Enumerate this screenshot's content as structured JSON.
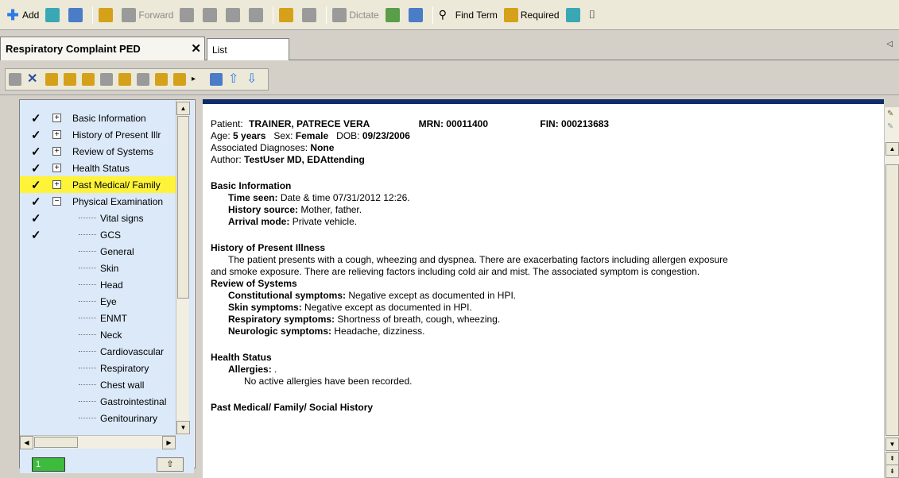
{
  "toolbar": {
    "add": "Add",
    "forward": "Forward",
    "dictate": "Dictate",
    "find_term": "Find Term",
    "required": "Required"
  },
  "tabs": {
    "active": "Respiratory Complaint PED",
    "close": "✕",
    "list": "List"
  },
  "tree": {
    "items": [
      {
        "label": "Basic Information",
        "checked": true,
        "expander": "+"
      },
      {
        "label": "History of Present Illr",
        "checked": true,
        "expander": "+"
      },
      {
        "label": "Review of Systems",
        "checked": true,
        "expander": "+"
      },
      {
        "label": "Health Status",
        "checked": true,
        "expander": "+"
      },
      {
        "label": "Past Medical/ Family",
        "checked": true,
        "expander": "+",
        "highlighted": true
      },
      {
        "label": "Physical Examination",
        "checked": true,
        "expander": "−"
      }
    ],
    "children": [
      {
        "label": "Vital signs",
        "checked": true
      },
      {
        "label": "GCS",
        "checked": true
      },
      {
        "label": "General"
      },
      {
        "label": "Skin"
      },
      {
        "label": "Head"
      },
      {
        "label": "Eye"
      },
      {
        "label": "ENMT"
      },
      {
        "label": "Neck"
      },
      {
        "label": "Cardiovascular"
      },
      {
        "label": "Respiratory"
      },
      {
        "label": "Chest wall"
      },
      {
        "label": "Gastrointestinal"
      },
      {
        "label": "Genitourinary"
      }
    ],
    "page_indicator": "1"
  },
  "document": {
    "patient_label": "Patient:",
    "patient_name": "TRAINER, PATRECE VERA",
    "mrn": "MRN: 00011400",
    "fin": "FIN: 000213683",
    "age_label": "Age:",
    "age": "5 years",
    "sex_label": "Sex:",
    "sex": "Female",
    "dob_label": "DOB:",
    "dob": "09/23/2006",
    "assoc_label": "Associated Diagnoses:",
    "assoc": "None",
    "author_label": "Author:",
    "author": "TestUser MD, EDAttending",
    "basic_title": "Basic Information",
    "time_seen_label": "Time seen:",
    "time_seen": "Date & time 07/31/2012 12:26.",
    "history_source_label": "History source:",
    "history_source": "Mother, father.",
    "arrival_label": "Arrival mode:",
    "arrival": "Private vehicle.",
    "hpi_title": "History of Present Illness",
    "hpi_line1": "The patient presents with a cough, wheezing and dyspnea.  There are exacerbating factors including allergen exposure",
    "hpi_line2": "and smoke exposure.  There are relieving factors including cold air and mist.  The associated symptom is congestion.",
    "ros_title": "Review of Systems",
    "constitutional_label": "Constitutional symptoms:",
    "constitutional": "Negative except as documented in HPI.",
    "skin_label": "Skin symptoms:",
    "skin": "Negative except as documented in HPI.",
    "respiratory_label": "Respiratory symptoms:",
    "respiratory": "Shortness of breath, cough, wheezing.",
    "neurologic_label": "Neurologic symptoms:",
    "neurologic": "Headache, dizziness.",
    "health_title": "Health Status",
    "allergies_label": "Allergies:",
    "allergies": ".",
    "allergies_note": "No active allergies have been recorded.",
    "pmh_title": "Past Medical/ Family/ Social History"
  }
}
